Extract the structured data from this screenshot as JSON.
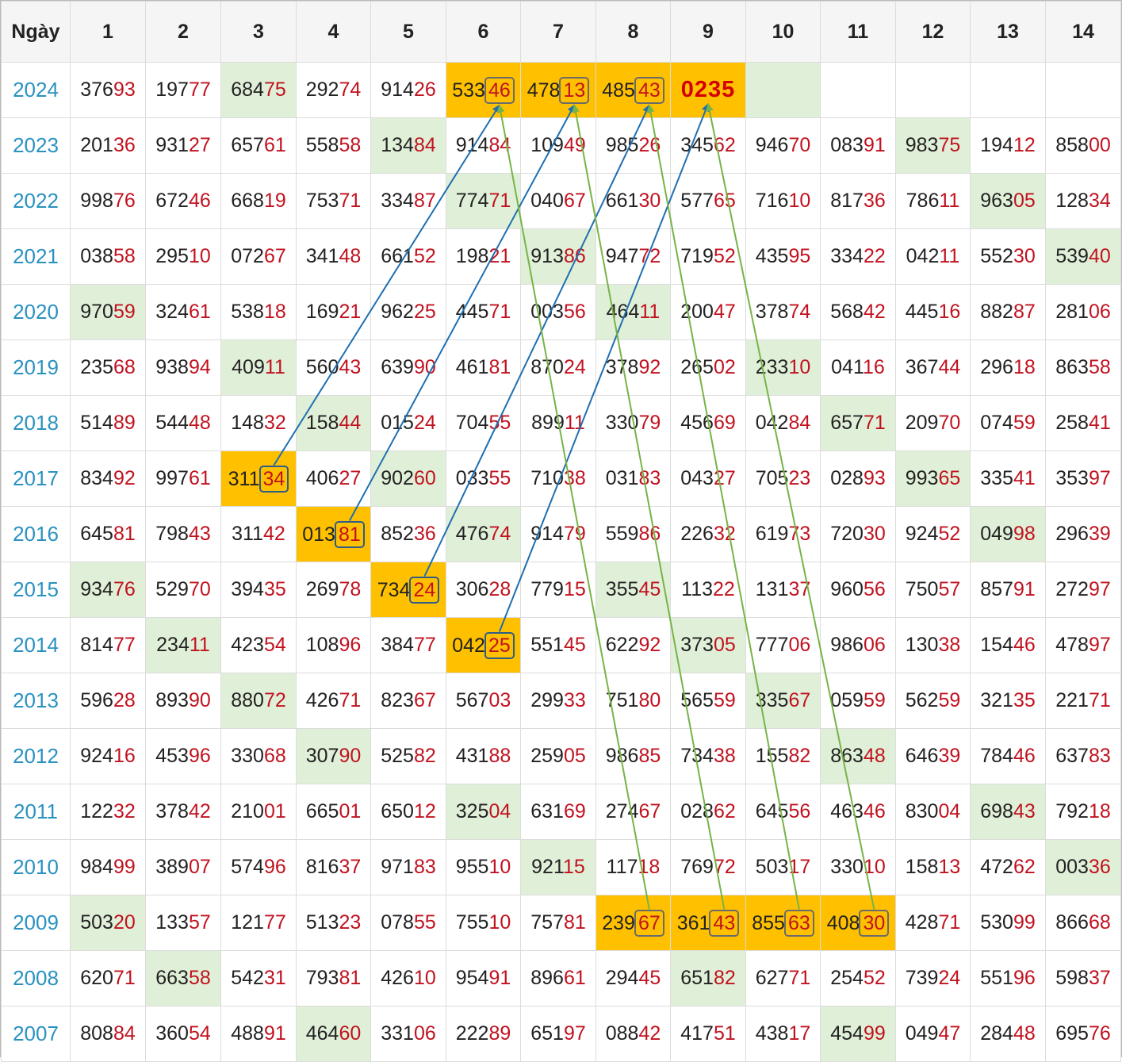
{
  "header": {
    "first_label": "Ngày",
    "days": [
      "1",
      "2",
      "3",
      "4",
      "5",
      "6",
      "7",
      "8",
      "9",
      "10",
      "11",
      "12",
      "13",
      "14"
    ]
  },
  "rows": [
    {
      "year": "2024",
      "cells": [
        {
          "v": "37693"
        },
        {
          "v": "19777"
        },
        {
          "v": "68475",
          "bg": "green"
        },
        {
          "v": "29274"
        },
        {
          "v": "91426"
        },
        {
          "v": "53346",
          "bg": "orange",
          "box": "gray"
        },
        {
          "v": "47813",
          "bg": "orange",
          "box": "gray"
        },
        {
          "v": "48543",
          "bg": "orange",
          "box": "gray"
        },
        {
          "v": "0235",
          "bg": "orange",
          "big": true
        },
        {
          "v": "",
          "bg": "green"
        },
        {
          "v": ""
        },
        {
          "v": ""
        },
        {
          "v": ""
        },
        {
          "v": ""
        }
      ]
    },
    {
      "year": "2023",
      "cells": [
        {
          "v": "20136"
        },
        {
          "v": "93127"
        },
        {
          "v": "65761"
        },
        {
          "v": "55858"
        },
        {
          "v": "13484",
          "bg": "green"
        },
        {
          "v": "91484"
        },
        {
          "v": "10949"
        },
        {
          "v": "98526"
        },
        {
          "v": "34562"
        },
        {
          "v": "94670"
        },
        {
          "v": "08391"
        },
        {
          "v": "98375",
          "bg": "green"
        },
        {
          "v": "19412"
        },
        {
          "v": "85800"
        }
      ]
    },
    {
      "year": "2022",
      "cells": [
        {
          "v": "99876"
        },
        {
          "v": "67246"
        },
        {
          "v": "66819"
        },
        {
          "v": "75371"
        },
        {
          "v": "33487"
        },
        {
          "v": "77471",
          "bg": "green"
        },
        {
          "v": "04067"
        },
        {
          "v": "66130"
        },
        {
          "v": "57765"
        },
        {
          "v": "71610"
        },
        {
          "v": "81736"
        },
        {
          "v": "78611"
        },
        {
          "v": "96305",
          "bg": "green"
        },
        {
          "v": "12834"
        }
      ]
    },
    {
      "year": "2021",
      "cells": [
        {
          "v": "03858"
        },
        {
          "v": "29510"
        },
        {
          "v": "07267"
        },
        {
          "v": "34148"
        },
        {
          "v": "66152"
        },
        {
          "v": "19821"
        },
        {
          "v": "91386",
          "bg": "green"
        },
        {
          "v": "94772"
        },
        {
          "v": "71952"
        },
        {
          "v": "43595"
        },
        {
          "v": "33422"
        },
        {
          "v": "04211"
        },
        {
          "v": "55230"
        },
        {
          "v": "53940",
          "bg": "green"
        }
      ]
    },
    {
      "year": "2020",
      "cells": [
        {
          "v": "97059",
          "bg": "green"
        },
        {
          "v": "32461"
        },
        {
          "v": "53818"
        },
        {
          "v": "16921"
        },
        {
          "v": "96225"
        },
        {
          "v": "44571"
        },
        {
          "v": "00356"
        },
        {
          "v": "46411",
          "bg": "green"
        },
        {
          "v": "20047"
        },
        {
          "v": "37874"
        },
        {
          "v": "56842"
        },
        {
          "v": "44516"
        },
        {
          "v": "88287"
        },
        {
          "v": "28106"
        }
      ]
    },
    {
      "year": "2019",
      "cells": [
        {
          "v": "23568"
        },
        {
          "v": "93894"
        },
        {
          "v": "40911",
          "bg": "green"
        },
        {
          "v": "56043"
        },
        {
          "v": "63990"
        },
        {
          "v": "46181"
        },
        {
          "v": "87024"
        },
        {
          "v": "37892"
        },
        {
          "v": "26502"
        },
        {
          "v": "23310",
          "bg": "green"
        },
        {
          "v": "04116"
        },
        {
          "v": "36744"
        },
        {
          "v": "29618"
        },
        {
          "v": "86358"
        }
      ]
    },
    {
      "year": "2018",
      "cells": [
        {
          "v": "51489"
        },
        {
          "v": "54448"
        },
        {
          "v": "14832"
        },
        {
          "v": "15844",
          "bg": "green"
        },
        {
          "v": "01524"
        },
        {
          "v": "70455"
        },
        {
          "v": "89911"
        },
        {
          "v": "33079"
        },
        {
          "v": "45669"
        },
        {
          "v": "04284"
        },
        {
          "v": "65771",
          "bg": "green"
        },
        {
          "v": "20970"
        },
        {
          "v": "07459"
        },
        {
          "v": "25841"
        }
      ]
    },
    {
      "year": "2017",
      "cells": [
        {
          "v": "83492"
        },
        {
          "v": "99761"
        },
        {
          "v": "31134",
          "bg": "orange",
          "box": "blue"
        },
        {
          "v": "40627"
        },
        {
          "v": "90260",
          "bg": "green"
        },
        {
          "v": "03355"
        },
        {
          "v": "71038"
        },
        {
          "v": "03183"
        },
        {
          "v": "04327"
        },
        {
          "v": "70523"
        },
        {
          "v": "02893"
        },
        {
          "v": "99365",
          "bg": "green"
        },
        {
          "v": "33541"
        },
        {
          "v": "35397"
        }
      ]
    },
    {
      "year": "2016",
      "cells": [
        {
          "v": "64581"
        },
        {
          "v": "79843"
        },
        {
          "v": "31142"
        },
        {
          "v": "01381",
          "bg": "orange",
          "box": "blue"
        },
        {
          "v": "85236"
        },
        {
          "v": "47674",
          "bg": "green"
        },
        {
          "v": "91479"
        },
        {
          "v": "55986"
        },
        {
          "v": "22632"
        },
        {
          "v": "61973"
        },
        {
          "v": "72030"
        },
        {
          "v": "92452"
        },
        {
          "v": "04998",
          "bg": "green"
        },
        {
          "v": "29639"
        }
      ]
    },
    {
      "year": "2015",
      "cells": [
        {
          "v": "93476",
          "bg": "green"
        },
        {
          "v": "52970"
        },
        {
          "v": "39435"
        },
        {
          "v": "26978"
        },
        {
          "v": "73424",
          "bg": "orange",
          "box": "blue"
        },
        {
          "v": "30628"
        },
        {
          "v": "77915"
        },
        {
          "v": "35545",
          "bg": "green"
        },
        {
          "v": "11322"
        },
        {
          "v": "13137"
        },
        {
          "v": "96056"
        },
        {
          "v": "75057"
        },
        {
          "v": "85791"
        },
        {
          "v": "27297"
        }
      ]
    },
    {
      "year": "2014",
      "cells": [
        {
          "v": "81477"
        },
        {
          "v": "23411",
          "bg": "green"
        },
        {
          "v": "42354"
        },
        {
          "v": "10896"
        },
        {
          "v": "38477"
        },
        {
          "v": "04225",
          "bg": "orange",
          "box": "blue"
        },
        {
          "v": "55145"
        },
        {
          "v": "62292"
        },
        {
          "v": "37305",
          "bg": "green"
        },
        {
          "v": "77706"
        },
        {
          "v": "98606"
        },
        {
          "v": "13038"
        },
        {
          "v": "15446"
        },
        {
          "v": "47897"
        }
      ]
    },
    {
      "year": "2013",
      "cells": [
        {
          "v": "59628"
        },
        {
          "v": "89390"
        },
        {
          "v": "88072",
          "bg": "green"
        },
        {
          "v": "42671"
        },
        {
          "v": "82367"
        },
        {
          "v": "56703"
        },
        {
          "v": "29933"
        },
        {
          "v": "75180"
        },
        {
          "v": "56559"
        },
        {
          "v": "33567",
          "bg": "green"
        },
        {
          "v": "05959"
        },
        {
          "v": "56259"
        },
        {
          "v": "32135"
        },
        {
          "v": "22171"
        }
      ]
    },
    {
      "year": "2012",
      "cells": [
        {
          "v": "92416"
        },
        {
          "v": "45396"
        },
        {
          "v": "33068"
        },
        {
          "v": "30790",
          "bg": "green"
        },
        {
          "v": "52582"
        },
        {
          "v": "43188"
        },
        {
          "v": "25905"
        },
        {
          "v": "98685"
        },
        {
          "v": "73438"
        },
        {
          "v": "15582"
        },
        {
          "v": "86348",
          "bg": "green"
        },
        {
          "v": "64639"
        },
        {
          "v": "78446"
        },
        {
          "v": "63783"
        }
      ]
    },
    {
      "year": "2011",
      "cells": [
        {
          "v": "12232"
        },
        {
          "v": "37842"
        },
        {
          "v": "21001"
        },
        {
          "v": "66501"
        },
        {
          "v": "65012"
        },
        {
          "v": "32504",
          "bg": "green"
        },
        {
          "v": "63169"
        },
        {
          "v": "27467"
        },
        {
          "v": "02862"
        },
        {
          "v": "64556"
        },
        {
          "v": "46346"
        },
        {
          "v": "83004"
        },
        {
          "v": "69843",
          "bg": "green"
        },
        {
          "v": "79218"
        }
      ]
    },
    {
      "year": "2010",
      "cells": [
        {
          "v": "98499"
        },
        {
          "v": "38907"
        },
        {
          "v": "57496"
        },
        {
          "v": "81637"
        },
        {
          "v": "97183"
        },
        {
          "v": "95510"
        },
        {
          "v": "92115",
          "bg": "green"
        },
        {
          "v": "11718"
        },
        {
          "v": "76972"
        },
        {
          "v": "50317"
        },
        {
          "v": "33010"
        },
        {
          "v": "15813"
        },
        {
          "v": "47262"
        },
        {
          "v": "00336",
          "bg": "green"
        }
      ]
    },
    {
      "year": "2009",
      "cells": [
        {
          "v": "50320",
          "bg": "green"
        },
        {
          "v": "13357"
        },
        {
          "v": "12177"
        },
        {
          "v": "51323"
        },
        {
          "v": "07855"
        },
        {
          "v": "75510"
        },
        {
          "v": "75781"
        },
        {
          "v": "23967",
          "bg": "orange",
          "box": "gray"
        },
        {
          "v": "36143",
          "bg": "orange",
          "box": "gray"
        },
        {
          "v": "85563",
          "bg": "orange",
          "box": "gray"
        },
        {
          "v": "40830",
          "bg": "orange",
          "box": "gray"
        },
        {
          "v": "42871"
        },
        {
          "v": "53099"
        },
        {
          "v": "86668"
        }
      ]
    },
    {
      "year": "2008",
      "cells": [
        {
          "v": "62071"
        },
        {
          "v": "66358",
          "bg": "green"
        },
        {
          "v": "54231"
        },
        {
          "v": "79381"
        },
        {
          "v": "42610"
        },
        {
          "v": "95491"
        },
        {
          "v": "89661"
        },
        {
          "v": "29445"
        },
        {
          "v": "65182",
          "bg": "green"
        },
        {
          "v": "62771"
        },
        {
          "v": "25452"
        },
        {
          "v": "73924"
        },
        {
          "v": "55196"
        },
        {
          "v": "59837"
        }
      ]
    },
    {
      "year": "2007",
      "cells": [
        {
          "v": "80884"
        },
        {
          "v": "36054"
        },
        {
          "v": "48891"
        },
        {
          "v": "46460",
          "bg": "green"
        },
        {
          "v": "33106"
        },
        {
          "v": "22289"
        },
        {
          "v": "65197"
        },
        {
          "v": "08842"
        },
        {
          "v": "41751"
        },
        {
          "v": "43817"
        },
        {
          "v": "45499",
          "bg": "green"
        },
        {
          "v": "04947"
        },
        {
          "v": "28448"
        },
        {
          "v": "69576"
        }
      ]
    }
  ],
  "arrows": {
    "blue": [
      {
        "from_year": "2017",
        "from_day": "3",
        "to_year": "2024",
        "to_day": "6"
      },
      {
        "from_year": "2016",
        "from_day": "4",
        "to_year": "2024",
        "to_day": "7"
      },
      {
        "from_year": "2015",
        "from_day": "5",
        "to_year": "2024",
        "to_day": "8"
      },
      {
        "from_year": "2014",
        "from_day": "6",
        "to_year": "2024",
        "to_day": "9"
      }
    ],
    "green": [
      {
        "from_year": "2009",
        "from_day": "8",
        "to_year": "2024",
        "to_day": "6"
      },
      {
        "from_year": "2009",
        "from_day": "9",
        "to_year": "2024",
        "to_day": "7"
      },
      {
        "from_year": "2009",
        "from_day": "10",
        "to_year": "2024",
        "to_day": "8"
      },
      {
        "from_year": "2009",
        "from_day": "11",
        "to_year": "2024",
        "to_day": "9"
      }
    ]
  },
  "colors": {
    "orange_highlight": "#ffc000",
    "green_highlight": "#e0f0d8",
    "tail_digits": "#c1121f",
    "year": "#2a92c0",
    "arrow_blue": "#1f6fb0",
    "arrow_green": "#77b347"
  }
}
